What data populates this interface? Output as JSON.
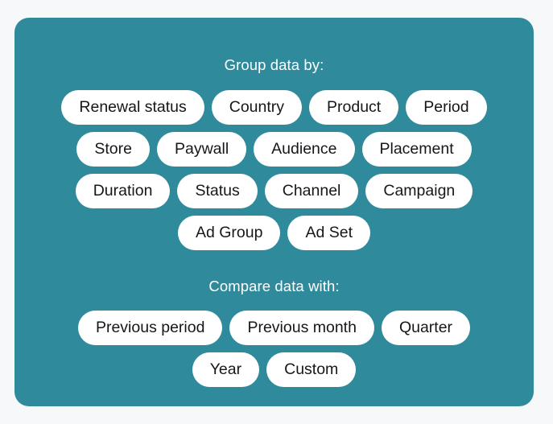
{
  "card": {
    "background_color": "#2f8a9b",
    "page_background_color": "#f7f8fa",
    "pill_background_color": "#ffffff",
    "pill_text_color": "#17171a",
    "title_color": "#ffffff"
  },
  "group_section": {
    "title": "Group data by:",
    "rows": [
      [
        {
          "label": "Renewal status"
        },
        {
          "label": "Country"
        },
        {
          "label": "Product"
        },
        {
          "label": "Period"
        }
      ],
      [
        {
          "label": "Store"
        },
        {
          "label": "Paywall"
        },
        {
          "label": "Audience"
        },
        {
          "label": "Placement"
        }
      ],
      [
        {
          "label": "Duration"
        },
        {
          "label": "Status"
        },
        {
          "label": "Channel"
        },
        {
          "label": "Campaign"
        }
      ],
      [
        {
          "label": "Ad Group"
        },
        {
          "label": "Ad Set"
        }
      ]
    ]
  },
  "compare_section": {
    "title": "Compare data with:",
    "rows": [
      [
        {
          "label": "Previous period"
        },
        {
          "label": "Previous month"
        },
        {
          "label": "Quarter"
        }
      ],
      [
        {
          "label": "Year"
        },
        {
          "label": "Custom"
        }
      ]
    ]
  }
}
